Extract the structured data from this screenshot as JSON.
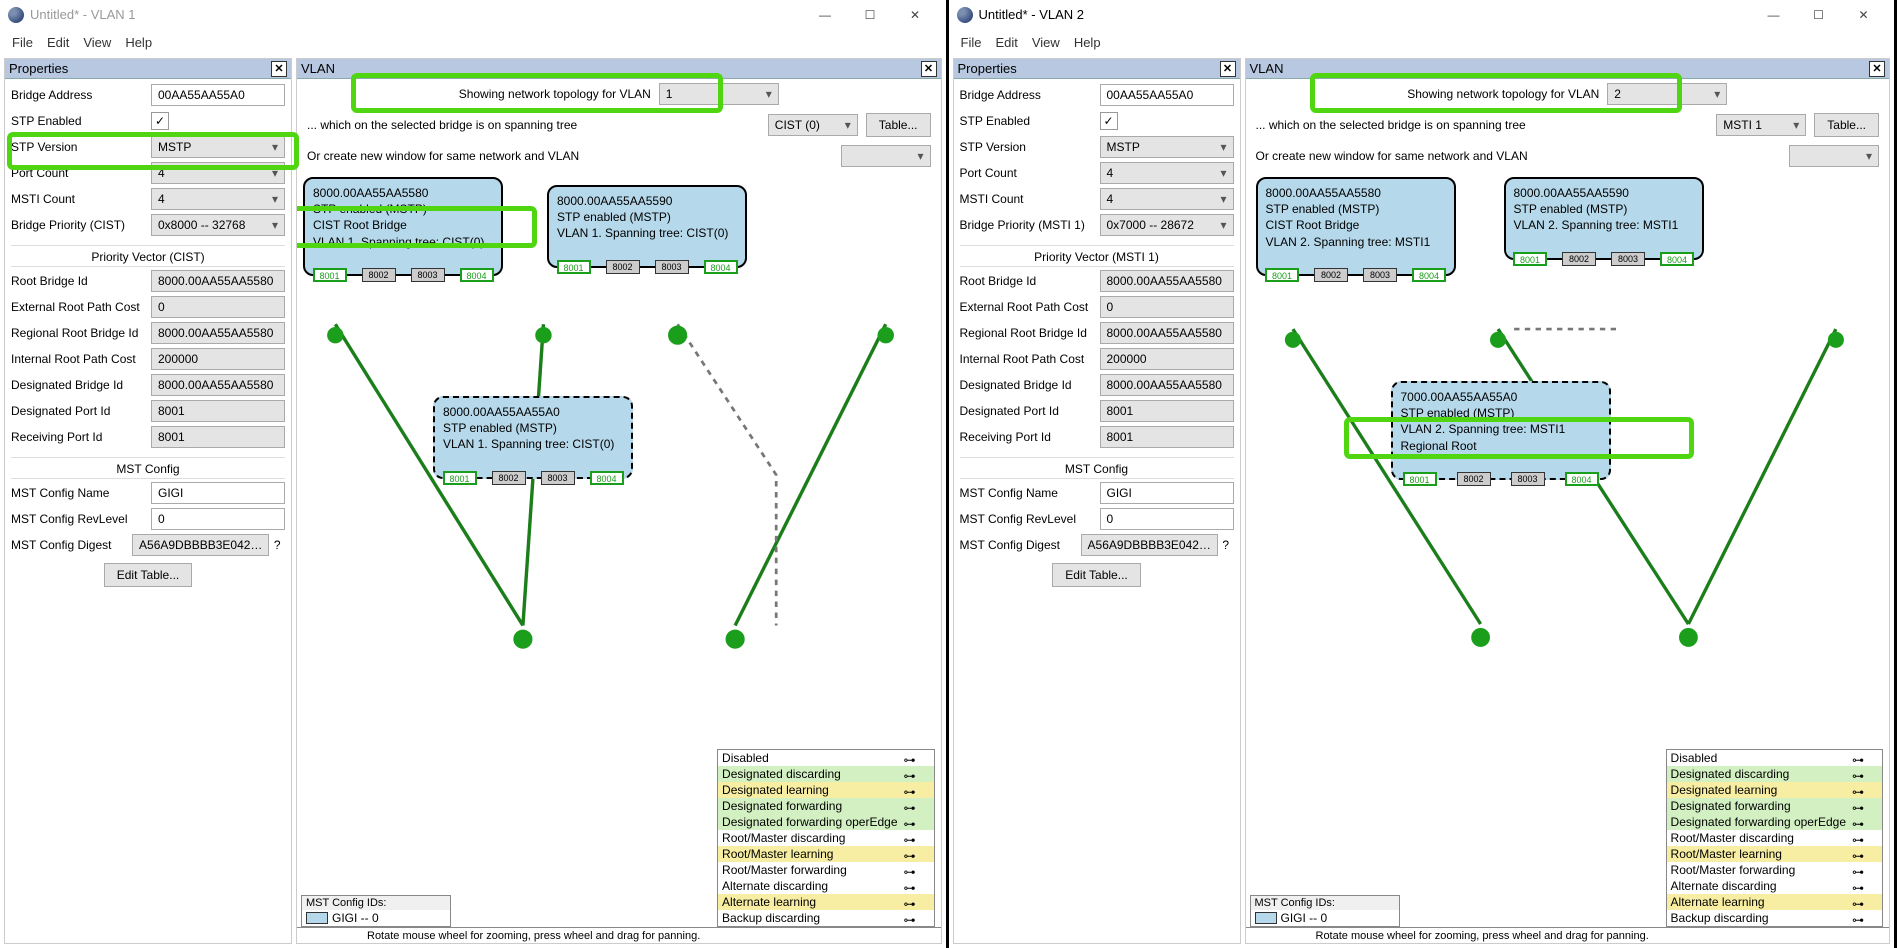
{
  "apps": [
    {
      "title": "Untitled* - VLAN 1",
      "active": false,
      "menu": [
        "File",
        "Edit",
        "View",
        "Help"
      ],
      "properties_title": "Properties",
      "vlan_title": "VLAN",
      "props": {
        "bridge_address_label": "Bridge Address",
        "bridge_address": "00AA55AA55A0",
        "stp_enabled_label": "STP Enabled",
        "stp_enabled": true,
        "stp_version_label": "STP Version",
        "stp_version": "MSTP",
        "port_count_label": "Port Count",
        "port_count": "4",
        "msti_count_label": "MSTI Count",
        "msti_count": "4",
        "bridge_priority_label": "Bridge Priority (CIST)",
        "bridge_priority": "0x8000 -- 32768",
        "pv_section": "Priority Vector (CIST)",
        "root_bridge_id_label": "Root Bridge Id",
        "root_bridge_id": "8000.00AA55AA5580",
        "ext_root_path_label": "External Root Path Cost",
        "ext_root_path": "0",
        "reg_root_id_label": "Regional Root Bridge Id",
        "reg_root_id": "8000.00AA55AA5580",
        "int_root_path_label": "Internal Root Path Cost",
        "int_root_path": "200000",
        "desig_bridge_label": "Designated Bridge Id",
        "desig_bridge": "8000.00AA55AA5580",
        "desig_port_label": "Designated Port Id",
        "desig_port": "8001",
        "recv_port_label": "Receiving Port Id",
        "recv_port": "8001",
        "mst_section": "MST Config",
        "mst_name_label": "MST Config Name",
        "mst_name": "GIGI",
        "mst_rev_label": "MST Config RevLevel",
        "mst_rev": "0",
        "mst_digest_label": "MST Config Digest",
        "mst_digest": "A56A9DBBBB3E042…",
        "edit_table": "Edit Table..."
      },
      "vlan": {
        "top_label": "Showing network topology for VLAN",
        "top_value": "1",
        "which_label": "... which on the selected bridge is on spanning tree",
        "which_value": "CIST (0)",
        "table_btn": "Table...",
        "create_label": "Or create new window for same network and VLAN",
        "bridges": {
          "a": {
            "id": "8000.00AA55AA5580",
            "l2": "STP enabled (MSTP)",
            "l3": "CIST Root Bridge",
            "l4": "VLAN 1. Spanning tree: CIST(0)"
          },
          "b": {
            "id": "8000.00AA55AA5590",
            "l2": "STP enabled (MSTP)",
            "l3": "VLAN 1. Spanning tree: CIST(0)"
          },
          "c": {
            "id": "8000.00AA55AA55A0",
            "l2": "STP enabled (MSTP)",
            "l3": "VLAN 1. Spanning tree: CIST(0)"
          }
        },
        "ports": [
          "8001",
          "8002",
          "8003",
          "8004"
        ],
        "mst_ids_title": "MST Config IDs:",
        "mst_ids_val": "GIGI -- 0",
        "status": "Rotate mouse wheel for zooming, press wheel and drag for panning."
      },
      "legend": [
        "Disabled",
        "Designated discarding",
        "Designated learning",
        "Designated forwarding",
        "Designated forwarding operEdge",
        "Root/Master discarding",
        "Root/Master learning",
        "Root/Master forwarding",
        "Alternate discarding",
        "Alternate learning",
        "Backup discarding"
      ]
    },
    {
      "title": "Untitled* - VLAN 2",
      "active": true,
      "menu": [
        "File",
        "Edit",
        "View",
        "Help"
      ],
      "properties_title": "Properties",
      "vlan_title": "VLAN",
      "props": {
        "bridge_address_label": "Bridge Address",
        "bridge_address": "00AA55AA55A0",
        "stp_enabled_label": "STP Enabled",
        "stp_enabled": true,
        "stp_version_label": "STP Version",
        "stp_version": "MSTP",
        "port_count_label": "Port Count",
        "port_count": "4",
        "msti_count_label": "MSTI Count",
        "msti_count": "4",
        "bridge_priority_label": "Bridge Priority (MSTI 1)",
        "bridge_priority": "0x7000 -- 28672",
        "pv_section": "Priority Vector (MSTI 1)",
        "root_bridge_id_label": "Root Bridge Id",
        "root_bridge_id": "8000.00AA55AA5580",
        "ext_root_path_label": "External Root Path Cost",
        "ext_root_path": "0",
        "reg_root_id_label": "Regional Root Bridge Id",
        "reg_root_id": "8000.00AA55AA5580",
        "int_root_path_label": "Internal Root Path Cost",
        "int_root_path": "200000",
        "desig_bridge_label": "Designated Bridge Id",
        "desig_bridge": "8000.00AA55AA5580",
        "desig_port_label": "Designated Port Id",
        "desig_port": "8001",
        "recv_port_label": "Receiving Port Id",
        "recv_port": "8001",
        "mst_section": "MST Config",
        "mst_name_label": "MST Config Name",
        "mst_name": "GIGI",
        "mst_rev_label": "MST Config RevLevel",
        "mst_rev": "0",
        "mst_digest_label": "MST Config Digest",
        "mst_digest": "A56A9DBBBB3E042…",
        "edit_table": "Edit Table..."
      },
      "vlan": {
        "top_label": "Showing network topology for VLAN",
        "top_value": "2",
        "which_label": "... which on the selected bridge is on spanning tree",
        "which_value": "MSTI 1",
        "table_btn": "Table...",
        "create_label": "Or create new window for same network and VLAN",
        "bridges": {
          "a": {
            "id": "8000.00AA55AA5580",
            "l2": "STP enabled (MSTP)",
            "l3": "CIST Root Bridge",
            "l4": "VLAN 2. Spanning tree: MSTI1"
          },
          "b": {
            "id": "8000.00AA55AA5590",
            "l2": "STP enabled (MSTP)",
            "l3": "VLAN 2. Spanning tree: MSTI1"
          },
          "c": {
            "id": "7000.00AA55AA55A0",
            "l2": "STP enabled (MSTP)",
            "l3": "VLAN 2. Spanning tree: MSTI1",
            "l4": "Regional Root"
          }
        },
        "ports": [
          "8001",
          "8002",
          "8003",
          "8004"
        ],
        "mst_ids_title": "MST Config IDs:",
        "mst_ids_val": "GIGI -- 0",
        "status": "Rotate mouse wheel for zooming, press wheel and drag for panning."
      },
      "legend": [
        "Disabled",
        "Designated discarding",
        "Designated learning",
        "Designated forwarding",
        "Designated forwarding operEdge",
        "Root/Master discarding",
        "Root/Master learning",
        "Root/Master forwarding",
        "Alternate discarding",
        "Alternate learning",
        "Backup discarding"
      ]
    }
  ],
  "legend_colors": [
    "",
    "lg-g",
    "lg-y",
    "lg-g",
    "lg-g",
    "",
    "lg-y",
    "",
    "",
    "lg-y",
    ""
  ]
}
